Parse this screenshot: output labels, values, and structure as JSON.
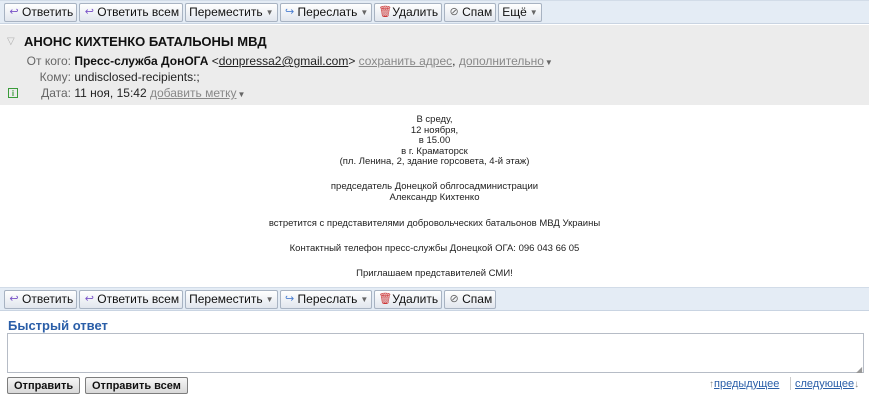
{
  "toolbar": {
    "reply": "Ответить",
    "reply_all": "Ответить всем",
    "move": "Переместить",
    "forward": "Переслать",
    "delete": "Удалить",
    "spam": "Спам",
    "more": "Ещё"
  },
  "message": {
    "subject": "АНОНС КИХТЕНКО БАТАЛЬОНЫ МВД",
    "from_label": "От кого:",
    "from_name": "Пресс-служба ДонОГА",
    "from_email_open": "<",
    "from_email": "donpressa2@gmail.com",
    "from_email_close": ">",
    "save_address": "сохранить адрес",
    "more_details": "дополнительно",
    "to_label": "Кому:",
    "to_value": "undisclosed-recipients:;",
    "date_label": "Дата:",
    "date_value": "11 ноя, 15:42",
    "add_tag": "добавить метку"
  },
  "body_lines": [
    "В среду,",
    "12 ноября,",
    "в 15.00",
    "в г. Краматорск",
    "(пл. Ленина, 2, здание горсовета, 4-й этаж)",
    "председатель Донецкой облгосадминистрации",
    "Александр Кихтенко",
    "встретится с представителями добровольческих батальонов МВД Украины",
    "Контактный телефон пресс-службы Донецкой ОГА: 096 043 66 05",
    "Приглашаем представителей СМИ!"
  ],
  "quick_reply": {
    "title": "Быстрый ответ",
    "send": "Отправить",
    "send_all": "Отправить всем",
    "prev": "предыдущее",
    "next": "следующее"
  },
  "icons": {
    "reply": "reply-arrow-icon",
    "reply_all": "reply-all-icon",
    "forward": "forward-arrow-icon",
    "delete": "trash-icon",
    "spam": "spam-icon",
    "dropdown": "chevron-down-icon"
  }
}
